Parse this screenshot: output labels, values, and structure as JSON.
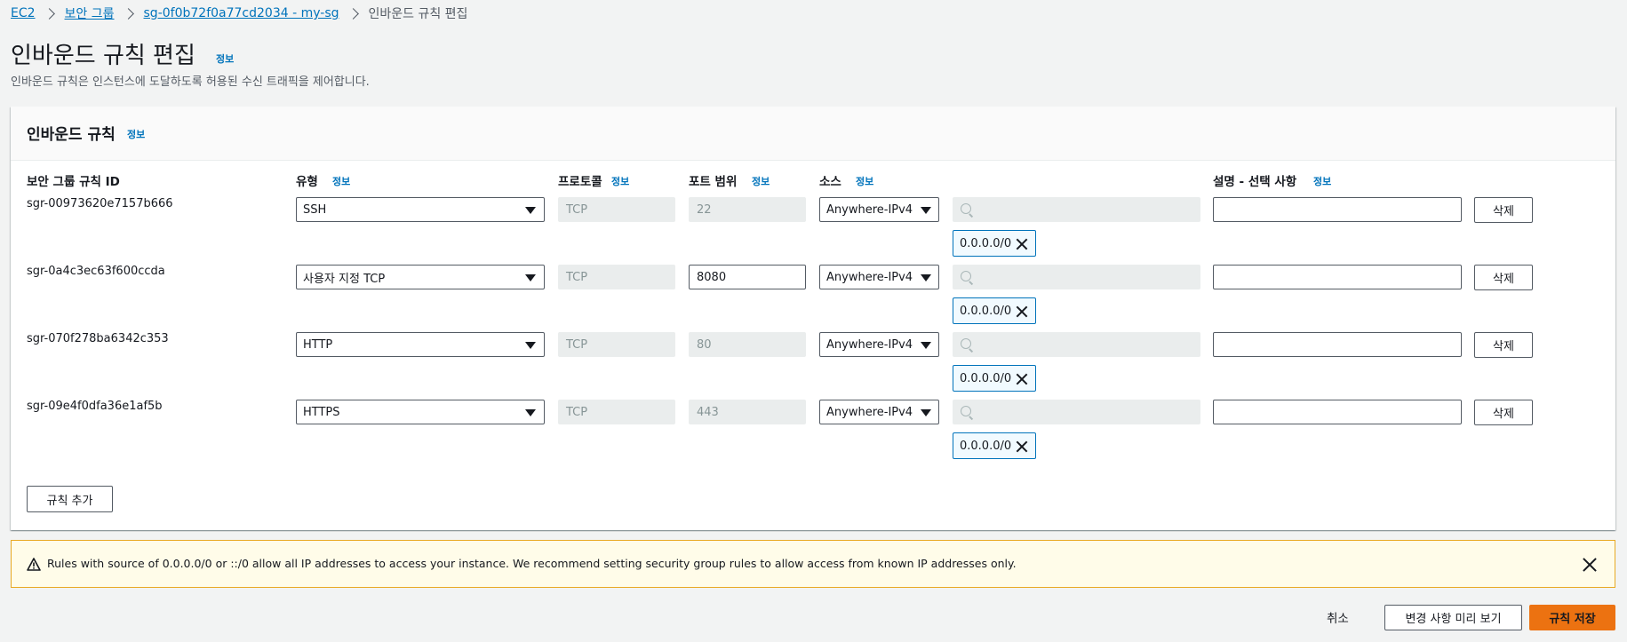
{
  "breadcrumb": {
    "items": [
      "EC2",
      "보안 그룹",
      "sg-0f0b72f0a77cd2034 - my-sg"
    ],
    "current": "인바운드 규칙 편집"
  },
  "page": {
    "title": "인바운드 규칙 편집",
    "info": "정보",
    "description": "인바운드 규칙은 인스턴스에 도달하도록 허용된 수신 트래픽을 제어합니다."
  },
  "panel": {
    "title": "인바운드 규칙",
    "info": "정보",
    "columns": {
      "rule_id": "보안 그룹 규칙 ID",
      "type": "유형",
      "protocol": "프로토콜",
      "port_range": "포트 범위",
      "source": "소스",
      "description": "설명 - 선택 사항",
      "info": "정보"
    },
    "rules": [
      {
        "id": "sgr-00973620e7157b666",
        "type": "SSH",
        "protocol": "TCP",
        "port": "22",
        "port_editable": false,
        "source": "Anywhere-IPv4",
        "cidr": "0.0.0.0/0",
        "description": "",
        "delete": "삭제"
      },
      {
        "id": "sgr-0a4c3ec63f600ccda",
        "type": "사용자 지정 TCP",
        "protocol": "TCP",
        "port": "8080",
        "port_editable": true,
        "source": "Anywhere-IPv4",
        "cidr": "0.0.0.0/0",
        "description": "",
        "delete": "삭제"
      },
      {
        "id": "sgr-070f278ba6342c353",
        "type": "HTTP",
        "protocol": "TCP",
        "port": "80",
        "port_editable": false,
        "source": "Anywhere-IPv4",
        "cidr": "0.0.0.0/0",
        "description": "",
        "delete": "삭제"
      },
      {
        "id": "sgr-09e4f0dfa36e1af5b",
        "type": "HTTPS",
        "protocol": "TCP",
        "port": "443",
        "port_editable": false,
        "source": "Anywhere-IPv4",
        "cidr": "0.0.0.0/0",
        "description": "",
        "delete": "삭제"
      }
    ],
    "add_rule": "규칙 추가"
  },
  "alert": {
    "text": "Rules with source of 0.0.0.0/0 or ::/0 allow all IP addresses to access your instance. We recommend setting security group rules to allow access from known IP addresses only."
  },
  "footer": {
    "cancel": "취소",
    "preview": "변경 사항 미리 보기",
    "save": "규칙 저장"
  },
  "colors": {
    "link": "#0073bb",
    "primary": "#ec7211",
    "alert_border": "#e8a923",
    "alert_bg": "#fffce9"
  }
}
